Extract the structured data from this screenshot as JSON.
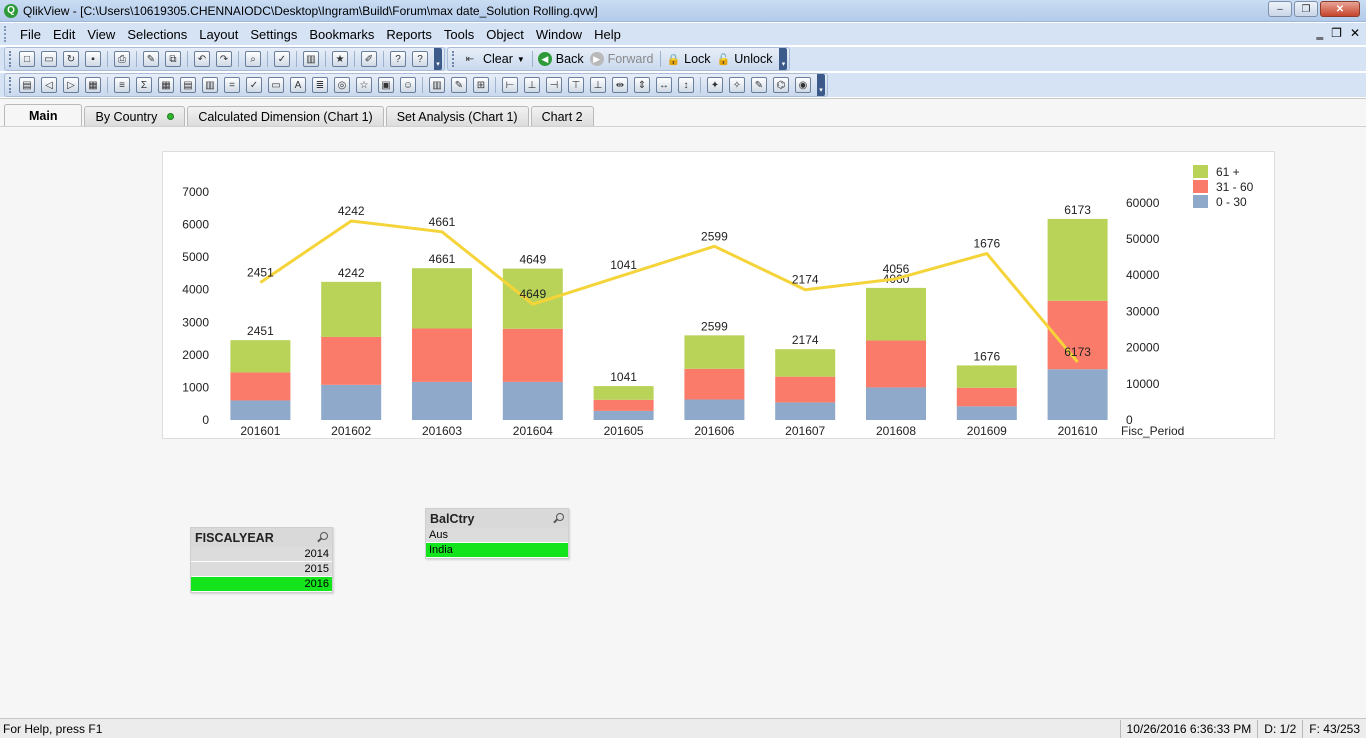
{
  "window": {
    "title": "QlikView - [C:\\Users\\10619305.CHENNAIODC\\Desktop\\Ingram\\Build\\Forum\\max date_Solution Rolling.qvw]"
  },
  "menu": [
    "File",
    "Edit",
    "View",
    "Selections",
    "Layout",
    "Settings",
    "Bookmarks",
    "Reports",
    "Tools",
    "Object",
    "Window",
    "Help"
  ],
  "toolbar": {
    "clear_label": "Clear",
    "back_label": "Back",
    "forward_label": "Forward",
    "lock_label": "Lock",
    "unlock_label": "Unlock"
  },
  "tabs": [
    {
      "label": "Main",
      "active": true
    },
    {
      "label": "By Country",
      "active": false
    },
    {
      "label": "Calculated Dimension (Chart 1)",
      "active": false
    },
    {
      "label": "Set Analysis (Chart 1)",
      "active": false
    },
    {
      "label": "Chart 2",
      "active": false
    }
  ],
  "chart_data": {
    "type": "bar",
    "title": "",
    "xlabel": "Fisc_Period",
    "categories": [
      "201601",
      "201602",
      "201603",
      "201604",
      "201605",
      "201606",
      "201607",
      "201608",
      "201609",
      "201610"
    ],
    "stacked": true,
    "series": [
      {
        "name": "0 - 30",
        "color": "#8EA9C9",
        "values": [
          600,
          1080,
          1170,
          1170,
          280,
          630,
          540,
          1000,
          420,
          1560
        ]
      },
      {
        "name": "31 - 60",
        "color": "#FB7B6A",
        "values": [
          860,
          1470,
          1640,
          1630,
          340,
          940,
          790,
          1440,
          570,
          2100
        ]
      },
      {
        "name": "61 +",
        "color": "#B8D358",
        "values": [
          991,
          1692,
          1851,
          1849,
          421,
          1029,
          844,
          1616,
          686,
          2513
        ]
      }
    ],
    "totals": [
      2451,
      4242,
      4661,
      4649,
      1041,
      2599,
      2174,
      4056,
      1676,
      6173
    ],
    "total_labels": [
      "2451",
      "4242",
      "4661",
      "4649",
      "1041",
      "2599",
      "2174",
      "4060",
      "1676",
      "6173"
    ],
    "line": {
      "color": "#F5D43A",
      "values": [
        38000,
        55000,
        52000,
        32000,
        40000,
        48000,
        36000,
        39000,
        46000,
        16000
      ],
      "labels": [
        "2451",
        "4242",
        "4661",
        "4649",
        "1041",
        "2599",
        "2174",
        "4056",
        "1676",
        "6173"
      ]
    },
    "ylim_left": [
      0,
      7000
    ],
    "yticks_left": [
      "0",
      "1000",
      "2000",
      "3000",
      "4000",
      "5000",
      "6000",
      "7000"
    ],
    "ylim_right": [
      0,
      63000
    ],
    "yticks_right": [
      "0",
      "10000",
      "20000",
      "30000",
      "40000",
      "50000",
      "60000"
    ],
    "legend_position": "top-right",
    "legend": [
      "61 +",
      "31 - 60",
      "0 - 30"
    ]
  },
  "listbox_fiscal": {
    "title": "FISCALYEAR",
    "rows": [
      {
        "value": "2014",
        "state": "excluded"
      },
      {
        "value": "2015",
        "state": "excluded"
      },
      {
        "value": "2016",
        "state": "selected"
      }
    ]
  },
  "listbox_ctry": {
    "title": "BalCtry",
    "rows": [
      {
        "value": "Aus",
        "state": "excluded"
      },
      {
        "value": "India",
        "state": "selected"
      }
    ]
  },
  "status": {
    "help": "For Help, press F1",
    "datetime": "10/26/2016 6:36:33 PM",
    "d": "D: 1/2",
    "f": "F: 43/253"
  }
}
